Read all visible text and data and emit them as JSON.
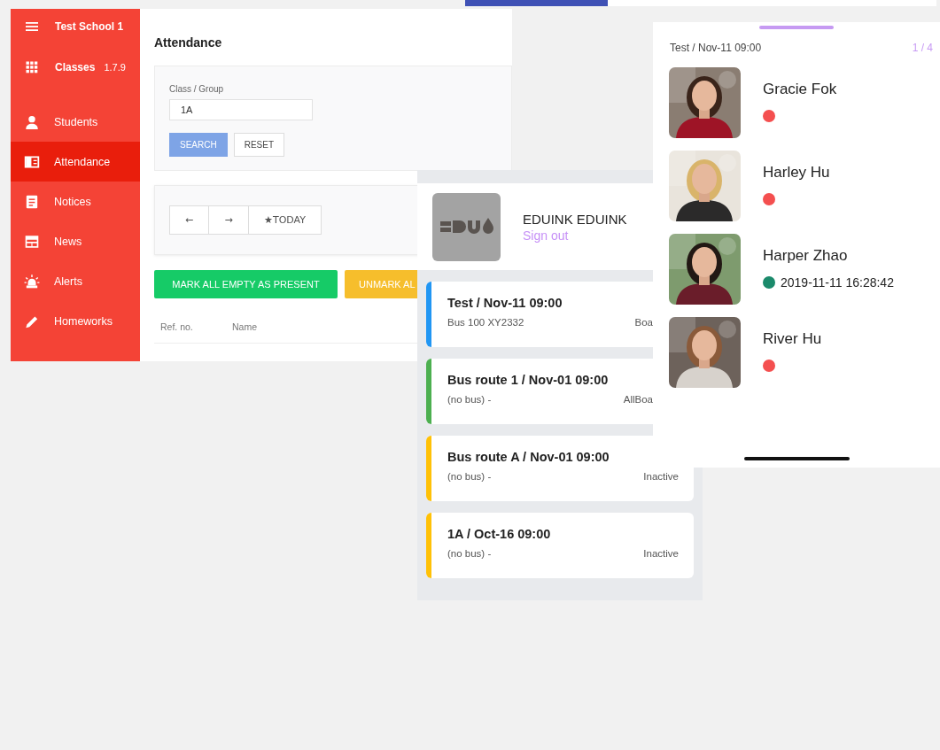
{
  "sidebar": {
    "school": "Test School 1",
    "classes": {
      "label": "Classes",
      "version": "1.7.9"
    },
    "items": [
      {
        "label": "Students",
        "selected": false
      },
      {
        "label": "Attendance",
        "selected": true
      },
      {
        "label": "Notices",
        "selected": false
      },
      {
        "label": "News",
        "selected": false
      },
      {
        "label": "Alerts",
        "selected": false
      },
      {
        "label": "Homeworks",
        "selected": false
      }
    ]
  },
  "attendance": {
    "title": "Attendance",
    "search": {
      "label": "Class / Group",
      "value": "1A",
      "buttons": [
        "SEARCH",
        "RESET"
      ]
    },
    "nav_buttons": [
      "←",
      "→",
      "★TODAY"
    ],
    "actions": [
      {
        "label": "MARK ALL EMPTY AS PRESENT",
        "kind": "present"
      },
      {
        "label": "UNMARK AL",
        "kind": "unmark"
      }
    ],
    "table": {
      "columns": [
        "Ref. no.",
        "Name"
      ]
    }
  },
  "mobile_list": {
    "user": "EDUINK EDUINK",
    "sign_out": "Sign out",
    "trips": [
      {
        "title": "Test / Nov-11 09:00",
        "subtitle": "Bus 100 XY2332",
        "status": "Boa",
        "color": "#2196f3"
      },
      {
        "title": "Bus route 1 / Nov-01 09:00",
        "subtitle": "(no bus) -",
        "status": "AllBoa",
        "color": "#4caf50"
      },
      {
        "title": "Bus route A / Nov-01 09:00",
        "subtitle": "(no bus) -",
        "status": "Inactive",
        "color": "#ffc107"
      },
      {
        "title": "1A / Oct-16 09:00",
        "subtitle": "(no bus) -",
        "status": "Inactive",
        "color": "#ffc107"
      }
    ]
  },
  "mobile_attendance": {
    "trip": "Test / Nov-11 09:00",
    "page": "1 / 4",
    "students": [
      {
        "name": "Gracie Fok",
        "color": "#f44f4f"
      },
      {
        "name": "Harley Hu",
        "color": "#f44f4f"
      },
      {
        "name": "Harper Zhao",
        "color": "#1b8a6b",
        "time": "2019-11-11 16:28:42"
      },
      {
        "name": "River Hu",
        "color": "#f44f4f"
      }
    ]
  }
}
